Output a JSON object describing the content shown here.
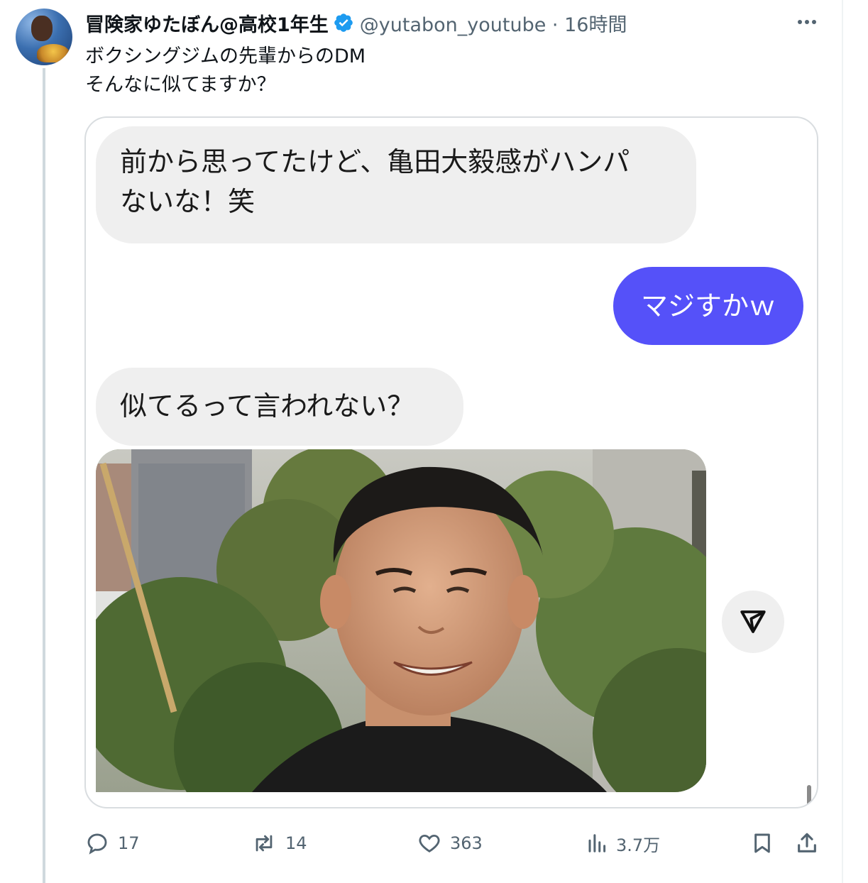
{
  "tweet": {
    "display_name": "冒険家ゆたぼん@高校1年生",
    "handle_time": "@yutabon_youtube · 16時間",
    "text_lines": [
      "ボクシングジムの先輩からのDM",
      "そんなに似てますか？"
    ],
    "verified": true,
    "badge_color": "#1d9bf0"
  },
  "dm": {
    "message1_lines": [
      "前から思ってたけど、亀田大毅感がハンパ",
      "ないな！笑"
    ],
    "message2": "マジすかｗ",
    "message3": "似てるって言われない？",
    "outgoing_bubble_color": "#5551f9",
    "incoming_bubble_color": "#efefef"
  },
  "actions": {
    "replies": "17",
    "retweets": "14",
    "likes": "363",
    "views": "3.7万"
  },
  "icons": {
    "more": "more-horizontal-icon",
    "verified": "verified-badge-icon",
    "reply": "reply-icon",
    "retweet": "retweet-icon",
    "like": "heart-icon",
    "views": "views-chart-icon",
    "bookmark": "bookmark-icon",
    "share": "share-icon",
    "send": "send-icon"
  }
}
